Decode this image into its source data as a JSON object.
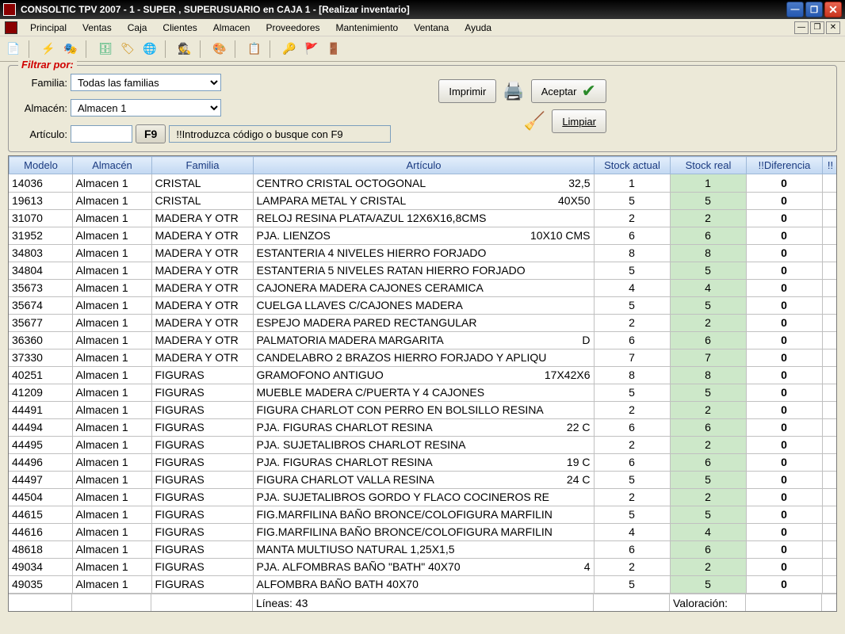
{
  "window": {
    "title": "CONSOLTIC TPV 2007 - 1 - SUPER , SUPERUSUARIO  en CAJA 1 - [Realizar inventario]"
  },
  "menu": {
    "items": [
      "Principal",
      "Ventas",
      "Caja",
      "Clientes",
      "Almacen",
      "Proveedores",
      "Mantenimiento",
      "Ventana",
      "Ayuda"
    ]
  },
  "filter": {
    "legend": "Filtrar por:",
    "familia_label": "Familia:",
    "familia_value": "Todas las familias",
    "almacen_label": "Almacén:",
    "almacen_value": "Almacen 1",
    "articulo_label": "Artículo:",
    "articulo_value": "",
    "f9_label": "F9",
    "hint": "!!Introduzca código o busque con F9",
    "imprimir": "Imprimir",
    "aceptar": "Aceptar",
    "limpiar": "Limpiar"
  },
  "columns": {
    "modelo": "Modelo",
    "almacen": "Almacén",
    "familia": "Familia",
    "articulo": "Artículo",
    "stock_actual": "Stock actual",
    "stock_real": "Stock real",
    "diferencia": "!!Diferencia",
    "extra": "!!"
  },
  "rows": [
    {
      "modelo": "14036",
      "almacen": "Almacen 1",
      "familia": "CRISTAL",
      "articulo": "CENTRO CRISTAL OCTOGONAL",
      "art_extra": "32,5",
      "sa": "1",
      "sr": "1",
      "d": "0"
    },
    {
      "modelo": "19613",
      "almacen": "Almacen 1",
      "familia": "CRISTAL",
      "articulo": "LAMPARA METAL Y CRISTAL",
      "art_extra": "40X50",
      "sa": "5",
      "sr": "5",
      "d": "0"
    },
    {
      "modelo": "31070",
      "almacen": "Almacen 1",
      "familia": "MADERA Y OTR",
      "articulo": "RELOJ RESINA PLATA/AZUL 12X6X16,8CMS",
      "art_extra": "",
      "sa": "2",
      "sr": "2",
      "d": "0"
    },
    {
      "modelo": "31952",
      "almacen": "Almacen 1",
      "familia": "MADERA Y OTR",
      "articulo": "PJA. LIENZOS",
      "art_extra": "10X10 CMS",
      "sa": "6",
      "sr": "6",
      "d": "0"
    },
    {
      "modelo": "34803",
      "almacen": "Almacen 1",
      "familia": "MADERA Y OTR",
      "articulo": "ESTANTERIA 4 NIVELES HIERRO FORJADO",
      "art_extra": "",
      "sa": "8",
      "sr": "8",
      "d": "0"
    },
    {
      "modelo": "34804",
      "almacen": "Almacen 1",
      "familia": "MADERA Y OTR",
      "articulo": "ESTANTERIA 5 NIVELES RATAN HIERRO FORJADO",
      "art_extra": "",
      "sa": "5",
      "sr": "5",
      "d": "0"
    },
    {
      "modelo": "35673",
      "almacen": "Almacen 1",
      "familia": "MADERA Y OTR",
      "articulo": "CAJONERA MADERA CAJONES CERAMICA",
      "art_extra": "",
      "sa": "4",
      "sr": "4",
      "d": "0"
    },
    {
      "modelo": "35674",
      "almacen": "Almacen 1",
      "familia": "MADERA Y OTR",
      "articulo": "CUELGA LLAVES C/CAJONES MADERA",
      "art_extra": "",
      "sa": "5",
      "sr": "5",
      "d": "0"
    },
    {
      "modelo": "35677",
      "almacen": "Almacen 1",
      "familia": "MADERA Y OTR",
      "articulo": "ESPEJO MADERA PARED RECTANGULAR",
      "art_extra": "",
      "sa": "2",
      "sr": "2",
      "d": "0"
    },
    {
      "modelo": "36360",
      "almacen": "Almacen 1",
      "familia": "MADERA Y OTR",
      "articulo": "PALMATORIA MADERA MARGARITA",
      "art_extra": "D",
      "sa": "6",
      "sr": "6",
      "d": "0"
    },
    {
      "modelo": "37330",
      "almacen": "Almacen 1",
      "familia": "MADERA Y OTR",
      "articulo": "CANDELABRO 2 BRAZOS HIERRO FORJADO Y APLIQU",
      "art_extra": "",
      "sa": "7",
      "sr": "7",
      "d": "0"
    },
    {
      "modelo": "40251",
      "almacen": "Almacen 1",
      "familia": "FIGURAS",
      "articulo": "GRAMOFONO ANTIGUO",
      "art_extra": "17X42X6",
      "sa": "8",
      "sr": "8",
      "d": "0"
    },
    {
      "modelo": "41209",
      "almacen": "Almacen 1",
      "familia": "FIGURAS",
      "articulo": "MUEBLE MADERA C/PUERTA Y 4 CAJONES",
      "art_extra": "",
      "sa": "5",
      "sr": "5",
      "d": "0"
    },
    {
      "modelo": "44491",
      "almacen": "Almacen 1",
      "familia": "FIGURAS",
      "articulo": "FIGURA CHARLOT CON PERRO EN BOLSILLO RESINA",
      "art_extra": "",
      "sa": "2",
      "sr": "2",
      "d": "0"
    },
    {
      "modelo": "44494",
      "almacen": "Almacen 1",
      "familia": "FIGURAS",
      "articulo": "PJA. FIGURAS CHARLOT RESINA",
      "art_extra": "22 C",
      "sa": "6",
      "sr": "6",
      "d": "0"
    },
    {
      "modelo": "44495",
      "almacen": "Almacen 1",
      "familia": "FIGURAS",
      "articulo": "PJA. SUJETALIBROS CHARLOT RESINA",
      "art_extra": "",
      "sa": "2",
      "sr": "2",
      "d": "0"
    },
    {
      "modelo": "44496",
      "almacen": "Almacen 1",
      "familia": "FIGURAS",
      "articulo": "PJA. FIGURAS CHARLOT RESINA",
      "art_extra": "19 C",
      "sa": "6",
      "sr": "6",
      "d": "0"
    },
    {
      "modelo": "44497",
      "almacen": "Almacen 1",
      "familia": "FIGURAS",
      "articulo": "FIGURA CHARLOT VALLA RESINA",
      "art_extra": "24 C",
      "sa": "5",
      "sr": "5",
      "d": "0"
    },
    {
      "modelo": "44504",
      "almacen": "Almacen 1",
      "familia": "FIGURAS",
      "articulo": "PJA. SUJETALIBROS GORDO Y FLACO COCINEROS RE",
      "art_extra": "",
      "sa": "2",
      "sr": "2",
      "d": "0"
    },
    {
      "modelo": "44615",
      "almacen": "Almacen 1",
      "familia": "FIGURAS",
      "articulo": "FIG.MARFILINA BAÑO BRONCE/COLOFIGURA MARFILIN",
      "art_extra": "",
      "sa": "5",
      "sr": "5",
      "d": "0"
    },
    {
      "modelo": "44616",
      "almacen": "Almacen 1",
      "familia": "FIGURAS",
      "articulo": "FIG.MARFILINA BAÑO BRONCE/COLOFIGURA MARFILIN",
      "art_extra": "",
      "sa": "4",
      "sr": "4",
      "d": "0"
    },
    {
      "modelo": "48618",
      "almacen": "Almacen 1",
      "familia": "FIGURAS",
      "articulo": "MANTA MULTIUSO NATURAL 1,25X1,5",
      "art_extra": "",
      "sa": "6",
      "sr": "6",
      "d": "0"
    },
    {
      "modelo": "49034",
      "almacen": "Almacen 1",
      "familia": "FIGURAS",
      "articulo": "PJA. ALFOMBRAS BAÑO \"BATH\" 40X70",
      "art_extra": "4",
      "sa": "2",
      "sr": "2",
      "d": "0"
    },
    {
      "modelo": "49035",
      "almacen": "Almacen 1",
      "familia": "FIGURAS",
      "articulo": "ALFOMBRA BAÑO BATH 40X70",
      "art_extra": "",
      "sa": "5",
      "sr": "5",
      "d": "0"
    }
  ],
  "footer": {
    "lineas": "Líneas: 43",
    "valoracion": "Valoración:"
  }
}
